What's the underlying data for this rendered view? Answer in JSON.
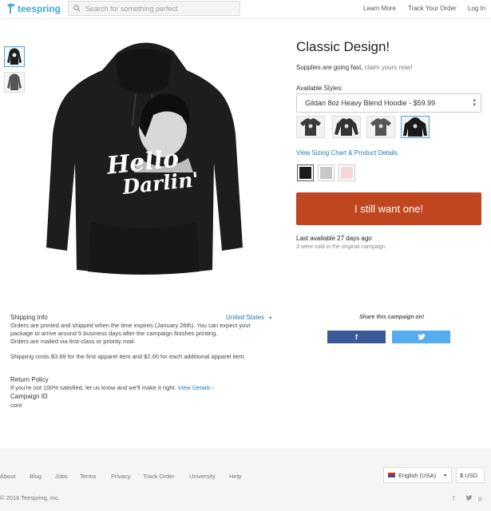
{
  "header": {
    "logo_text": "teespring",
    "search_placeholder": "Search for something perfect",
    "nav": [
      "Learn More",
      "Track Your Order",
      "Log In"
    ]
  },
  "product": {
    "title": "Classic Design!",
    "supplies_text": "Supplies are going fast,",
    "supplies_link": "claim yours now!",
    "styles_label": "Available Styles:",
    "selected_style": "Gildan 8oz Heavy Blend Hoodie - $59.99",
    "sizing_link": "View Sizing Chart & Product Details",
    "cta_label": "I still want one!",
    "last_available": "Last available 27 days ago",
    "sold_text": "3 were sold in the original campaign",
    "colors": [
      "#1c1c1c",
      "#c8c8ca",
      "#f6d6d8"
    ],
    "hoodie_text": [
      "Hello",
      "Darlin'"
    ]
  },
  "shipping": {
    "title": "Shipping Info",
    "country": "United States",
    "lines": [
      "Orders are printed and shipped when the time expires (January 26th). You can expect your",
      "package to arrive around 5 business days after the campaign finishes printing.",
      "Orders are mailed via first-class or priority mail."
    ],
    "cost": "Shipping costs $3.99 for the first apparel item and $2.00 for each additional apparel item."
  },
  "return_policy": {
    "title": "Return Policy",
    "text": "If you're not 100% satisfied, let us know and we'll make it right.",
    "link": "View Details"
  },
  "campaign": {
    "title": "Campaign ID",
    "value": "cont"
  },
  "share": {
    "label": "Share this campaign on!",
    "facebook": "f",
    "twitter": "twitter-bird"
  },
  "footer": {
    "links": [
      "About",
      "Blog",
      "Jobs",
      "Terms",
      "Privacy",
      "Track Order",
      "University",
      "Help"
    ],
    "language": "English (USA)",
    "currency": "$ USD",
    "copyright": "© 2016 Teespring, Inc."
  }
}
